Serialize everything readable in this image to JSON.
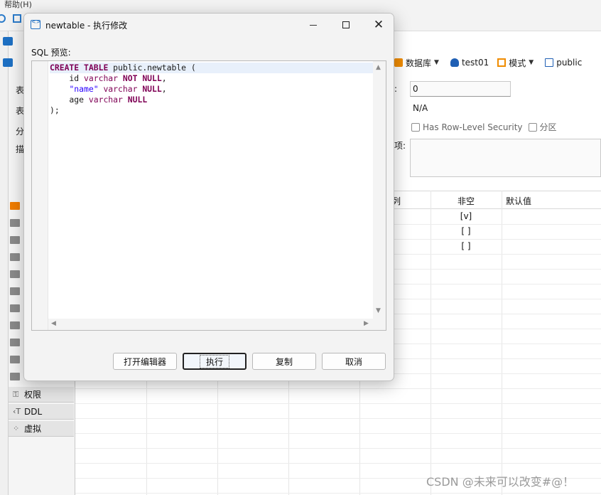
{
  "menubar": {
    "help": "帮助(H)"
  },
  "leftpanel": {
    "side_labels": [
      "表",
      "表",
      "分",
      "描"
    ],
    "rows": [
      {
        "icon": "key-icon",
        "glyph": "⚿",
        "label": "权限"
      },
      {
        "icon": "ddl-icon",
        "glyph": "‹T",
        "label": "DDL"
      },
      {
        "icon": "virtual-icon",
        "glyph": "⁘",
        "label": "虚拟"
      }
    ]
  },
  "right_toolbar": {
    "database": "数据库",
    "connection": "test01",
    "schema_type": "模式",
    "schema": "public"
  },
  "properties": {
    "colon_label": ":",
    "value_field": "0",
    "na": "N/A",
    "rls_label": "Has Row-Level Security",
    "partition_label": "分区",
    "options_label": "项:"
  },
  "grid": {
    "headers": [
      "列",
      "非空",
      "默认值"
    ],
    "not_null_values": [
      "[v]",
      "[ ]",
      "[ ]"
    ]
  },
  "dialog": {
    "title": "newtable - 执行修改",
    "sql_label": "SQL 预览:",
    "sql_lines": [
      "CREATE TABLE public.newtable (",
      "    id varchar NOT NULL,",
      "    \"name\" varchar NULL,",
      "    age varchar NULL",
      ");"
    ],
    "buttons": {
      "open_editor": "打开编辑器",
      "execute": "执行",
      "copy": "复制",
      "cancel": "取消"
    }
  },
  "watermark": "CSDN @未来可以改变#@！",
  "colors": {
    "accent": "#1f6fc2",
    "keyword": "#7f0055",
    "string": "#2a00ff"
  }
}
